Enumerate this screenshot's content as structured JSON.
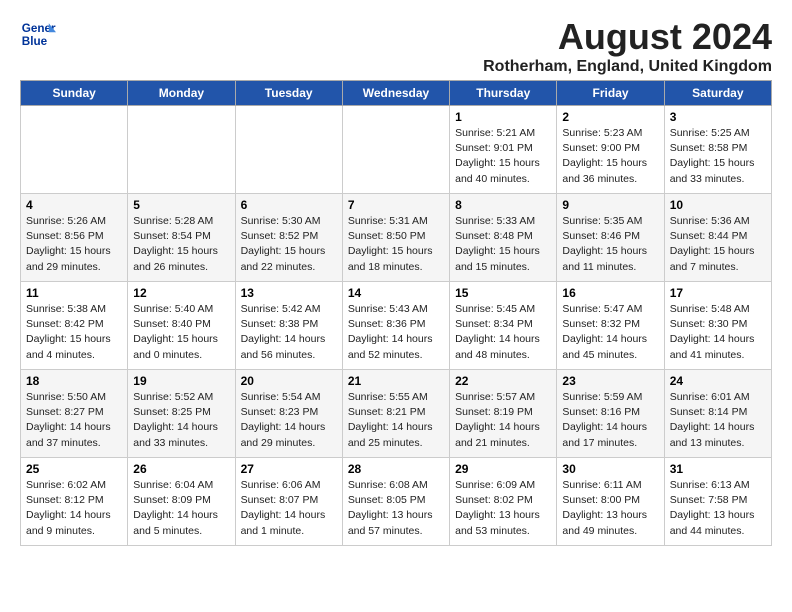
{
  "header": {
    "logo_line1": "General",
    "logo_line2": "Blue",
    "month_year": "August 2024",
    "location": "Rotherham, England, United Kingdom"
  },
  "days_of_week": [
    "Sunday",
    "Monday",
    "Tuesday",
    "Wednesday",
    "Thursday",
    "Friday",
    "Saturday"
  ],
  "weeks": [
    [
      {
        "day": "",
        "info": ""
      },
      {
        "day": "",
        "info": ""
      },
      {
        "day": "",
        "info": ""
      },
      {
        "day": "",
        "info": ""
      },
      {
        "day": "1",
        "info": "Sunrise: 5:21 AM\nSunset: 9:01 PM\nDaylight: 15 hours\nand 40 minutes."
      },
      {
        "day": "2",
        "info": "Sunrise: 5:23 AM\nSunset: 9:00 PM\nDaylight: 15 hours\nand 36 minutes."
      },
      {
        "day": "3",
        "info": "Sunrise: 5:25 AM\nSunset: 8:58 PM\nDaylight: 15 hours\nand 33 minutes."
      }
    ],
    [
      {
        "day": "4",
        "info": "Sunrise: 5:26 AM\nSunset: 8:56 PM\nDaylight: 15 hours\nand 29 minutes."
      },
      {
        "day": "5",
        "info": "Sunrise: 5:28 AM\nSunset: 8:54 PM\nDaylight: 15 hours\nand 26 minutes."
      },
      {
        "day": "6",
        "info": "Sunrise: 5:30 AM\nSunset: 8:52 PM\nDaylight: 15 hours\nand 22 minutes."
      },
      {
        "day": "7",
        "info": "Sunrise: 5:31 AM\nSunset: 8:50 PM\nDaylight: 15 hours\nand 18 minutes."
      },
      {
        "day": "8",
        "info": "Sunrise: 5:33 AM\nSunset: 8:48 PM\nDaylight: 15 hours\nand 15 minutes."
      },
      {
        "day": "9",
        "info": "Sunrise: 5:35 AM\nSunset: 8:46 PM\nDaylight: 15 hours\nand 11 minutes."
      },
      {
        "day": "10",
        "info": "Sunrise: 5:36 AM\nSunset: 8:44 PM\nDaylight: 15 hours\nand 7 minutes."
      }
    ],
    [
      {
        "day": "11",
        "info": "Sunrise: 5:38 AM\nSunset: 8:42 PM\nDaylight: 15 hours\nand 4 minutes."
      },
      {
        "day": "12",
        "info": "Sunrise: 5:40 AM\nSunset: 8:40 PM\nDaylight: 15 hours\nand 0 minutes."
      },
      {
        "day": "13",
        "info": "Sunrise: 5:42 AM\nSunset: 8:38 PM\nDaylight: 14 hours\nand 56 minutes."
      },
      {
        "day": "14",
        "info": "Sunrise: 5:43 AM\nSunset: 8:36 PM\nDaylight: 14 hours\nand 52 minutes."
      },
      {
        "day": "15",
        "info": "Sunrise: 5:45 AM\nSunset: 8:34 PM\nDaylight: 14 hours\nand 48 minutes."
      },
      {
        "day": "16",
        "info": "Sunrise: 5:47 AM\nSunset: 8:32 PM\nDaylight: 14 hours\nand 45 minutes."
      },
      {
        "day": "17",
        "info": "Sunrise: 5:48 AM\nSunset: 8:30 PM\nDaylight: 14 hours\nand 41 minutes."
      }
    ],
    [
      {
        "day": "18",
        "info": "Sunrise: 5:50 AM\nSunset: 8:27 PM\nDaylight: 14 hours\nand 37 minutes."
      },
      {
        "day": "19",
        "info": "Sunrise: 5:52 AM\nSunset: 8:25 PM\nDaylight: 14 hours\nand 33 minutes."
      },
      {
        "day": "20",
        "info": "Sunrise: 5:54 AM\nSunset: 8:23 PM\nDaylight: 14 hours\nand 29 minutes."
      },
      {
        "day": "21",
        "info": "Sunrise: 5:55 AM\nSunset: 8:21 PM\nDaylight: 14 hours\nand 25 minutes."
      },
      {
        "day": "22",
        "info": "Sunrise: 5:57 AM\nSunset: 8:19 PM\nDaylight: 14 hours\nand 21 minutes."
      },
      {
        "day": "23",
        "info": "Sunrise: 5:59 AM\nSunset: 8:16 PM\nDaylight: 14 hours\nand 17 minutes."
      },
      {
        "day": "24",
        "info": "Sunrise: 6:01 AM\nSunset: 8:14 PM\nDaylight: 14 hours\nand 13 minutes."
      }
    ],
    [
      {
        "day": "25",
        "info": "Sunrise: 6:02 AM\nSunset: 8:12 PM\nDaylight: 14 hours\nand 9 minutes."
      },
      {
        "day": "26",
        "info": "Sunrise: 6:04 AM\nSunset: 8:09 PM\nDaylight: 14 hours\nand 5 minutes."
      },
      {
        "day": "27",
        "info": "Sunrise: 6:06 AM\nSunset: 8:07 PM\nDaylight: 14 hours\nand 1 minute."
      },
      {
        "day": "28",
        "info": "Sunrise: 6:08 AM\nSunset: 8:05 PM\nDaylight: 13 hours\nand 57 minutes."
      },
      {
        "day": "29",
        "info": "Sunrise: 6:09 AM\nSunset: 8:02 PM\nDaylight: 13 hours\nand 53 minutes."
      },
      {
        "day": "30",
        "info": "Sunrise: 6:11 AM\nSunset: 8:00 PM\nDaylight: 13 hours\nand 49 minutes."
      },
      {
        "day": "31",
        "info": "Sunrise: 6:13 AM\nSunset: 7:58 PM\nDaylight: 13 hours\nand 44 minutes."
      }
    ]
  ]
}
